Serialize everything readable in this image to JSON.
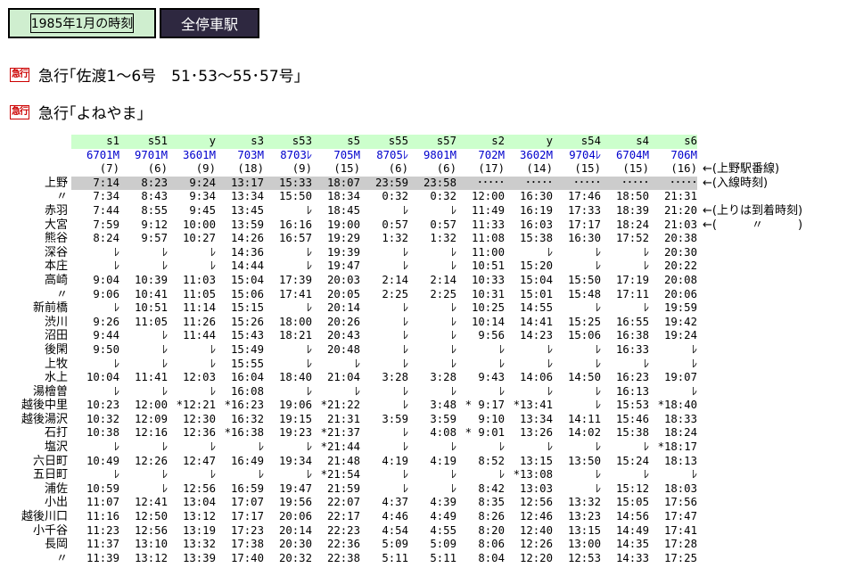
{
  "header": {
    "date_label": "1985年1月の時刻",
    "all_stations_label": "全停車駅"
  },
  "links": [
    {
      "icon": "急行",
      "label": "急行｢佐渡1～6号　51･53～55･57号｣"
    },
    {
      "icon": "急行",
      "label": "急行｢よねやま｣"
    }
  ],
  "timetable": {
    "types": [
      "s1",
      "s51",
      "y",
      "s3",
      "s53",
      "s5",
      "s55",
      "s57",
      "s2",
      "y",
      "s54",
      "s4",
      "s6"
    ],
    "numbers": [
      "6701M",
      "9701M",
      "3601M",
      "703M",
      "8703ﾚ",
      "705M",
      "8705ﾚ",
      "9801M",
      "702M",
      "3602M",
      "9704ﾚ",
      "6704M",
      "706M"
    ],
    "ueno_tracks": [
      "(7)",
      "(6)",
      "(9)",
      "(18)",
      "(9)",
      "(15)",
      "(6)",
      "(6)",
      "(17)",
      "(14)",
      "(15)",
      "(15)",
      "(16)"
    ],
    "ueno_tracks_note": "←(上野駅番線)",
    "rows": [
      {
        "station": "上野",
        "note": "←(入線時刻)",
        "times": [
          "7:14",
          "8:23",
          "9:24",
          "13:17",
          "15:33",
          "18:07",
          "23:59",
          "23:58",
          "･････",
          "･････",
          "･････",
          "･････",
          "･････"
        ]
      },
      {
        "station": "〃",
        "note": "",
        "times": [
          "7:34",
          "8:43",
          "9:34",
          "13:34",
          "15:50",
          "18:34",
          "0:32",
          "0:32",
          "12:00",
          "16:30",
          "17:46",
          "18:50",
          "21:31"
        ]
      },
      {
        "station": "赤羽",
        "note": "←(上りは到着時刻)",
        "times": [
          "7:44",
          "8:55",
          "9:45",
          "13:45",
          "ﾚ",
          "18:45",
          "ﾚ",
          "ﾚ",
          "11:49",
          "16:19",
          "17:33",
          "18:39",
          "21:20"
        ]
      },
      {
        "station": "大宮",
        "note": "←(　　　〃　　　)",
        "times": [
          "7:59",
          "9:12",
          "10:00",
          "13:59",
          "16:16",
          "19:00",
          "0:57",
          "0:57",
          "11:33",
          "16:03",
          "17:17",
          "18:24",
          "21:03"
        ]
      },
      {
        "station": "熊谷",
        "note": "",
        "times": [
          "8:24",
          "9:57",
          "10:27",
          "14:26",
          "16:57",
          "19:29",
          "1:32",
          "1:32",
          "11:08",
          "15:38",
          "16:30",
          "17:52",
          "20:38"
        ]
      },
      {
        "station": "深谷",
        "note": "",
        "times": [
          "ﾚ",
          "ﾚ",
          "ﾚ",
          "14:36",
          "ﾚ",
          "19:39",
          "ﾚ",
          "ﾚ",
          "11:00",
          "ﾚ",
          "ﾚ",
          "ﾚ",
          "20:30"
        ]
      },
      {
        "station": "本庄",
        "note": "",
        "times": [
          "ﾚ",
          "ﾚ",
          "ﾚ",
          "14:44",
          "ﾚ",
          "19:47",
          "ﾚ",
          "ﾚ",
          "10:51",
          "15:20",
          "ﾚ",
          "ﾚ",
          "20:22"
        ]
      },
      {
        "station": "高崎",
        "note": "",
        "times": [
          "9:04",
          "10:39",
          "11:03",
          "15:04",
          "17:39",
          "20:03",
          "2:14",
          "2:14",
          "10:33",
          "15:04",
          "15:50",
          "17:19",
          "20:08"
        ]
      },
      {
        "station": "〃",
        "note": "",
        "times": [
          "9:06",
          "10:41",
          "11:05",
          "15:06",
          "17:41",
          "20:05",
          "2:25",
          "2:25",
          "10:31",
          "15:01",
          "15:48",
          "17:11",
          "20:06"
        ]
      },
      {
        "station": "新前橋",
        "note": "",
        "times": [
          "ﾚ",
          "10:51",
          "11:14",
          "15:15",
          "ﾚ",
          "20:14",
          "ﾚ",
          "ﾚ",
          "10:25",
          "14:55",
          "ﾚ",
          "ﾚ",
          "19:59"
        ]
      },
      {
        "station": "渋川",
        "note": "",
        "times": [
          "9:26",
          "11:05",
          "11:26",
          "15:26",
          "18:00",
          "20:26",
          "ﾚ",
          "ﾚ",
          "10:14",
          "14:41",
          "15:25",
          "16:55",
          "19:42"
        ]
      },
      {
        "station": "沼田",
        "note": "",
        "times": [
          "9:44",
          "ﾚ",
          "11:44",
          "15:43",
          "18:21",
          "20:43",
          "ﾚ",
          "ﾚ",
          "9:56",
          "14:23",
          "15:06",
          "16:38",
          "19:24"
        ]
      },
      {
        "station": "後閑",
        "note": "",
        "times": [
          "9:50",
          "ﾚ",
          "ﾚ",
          "15:49",
          "ﾚ",
          "20:48",
          "ﾚ",
          "ﾚ",
          "ﾚ",
          "ﾚ",
          "ﾚ",
          "16:33",
          "ﾚ"
        ]
      },
      {
        "station": "上牧",
        "note": "",
        "times": [
          "ﾚ",
          "ﾚ",
          "ﾚ",
          "15:55",
          "ﾚ",
          "ﾚ",
          "ﾚ",
          "ﾚ",
          "ﾚ",
          "ﾚ",
          "ﾚ",
          "ﾚ",
          "ﾚ"
        ]
      },
      {
        "station": "水上",
        "note": "",
        "times": [
          "10:04",
          "11:41",
          "12:03",
          "16:04",
          "18:40",
          "21:04",
          "3:28",
          "3:28",
          "9:43",
          "14:06",
          "14:50",
          "16:23",
          "19:07"
        ]
      },
      {
        "station": "湯檜曽",
        "note": "",
        "times": [
          "ﾚ",
          "ﾚ",
          "ﾚ",
          "16:08",
          "ﾚ",
          "ﾚ",
          "ﾚ",
          "ﾚ",
          "ﾚ",
          "ﾚ",
          "ﾚ",
          "16:13",
          "ﾚ"
        ]
      },
      {
        "station": "越後中里",
        "note": "",
        "times": [
          "10:23",
          "12:00",
          "*12:21",
          "*16:23",
          "19:06",
          "*21:22",
          "ﾚ",
          "3:48",
          "* 9:17",
          "*13:41",
          "ﾚ",
          "15:53",
          "*18:40"
        ]
      },
      {
        "station": "越後湯沢",
        "note": "",
        "times": [
          "10:32",
          "12:09",
          "12:30",
          "16:32",
          "19:15",
          "21:31",
          "3:59",
          "3:59",
          "9:10",
          "13:34",
          "14:11",
          "15:46",
          "18:33"
        ]
      },
      {
        "station": "石打",
        "note": "",
        "times": [
          "10:38",
          "12:16",
          "12:36",
          "*16:38",
          "19:23",
          "*21:37",
          "ﾚ",
          "4:08",
          "* 9:01",
          "13:26",
          "14:02",
          "15:38",
          "18:24"
        ]
      },
      {
        "station": "塩沢",
        "note": "",
        "times": [
          "ﾚ",
          "ﾚ",
          "ﾚ",
          "ﾚ",
          "ﾚ",
          "*21:44",
          "ﾚ",
          "ﾚ",
          "ﾚ",
          "ﾚ",
          "ﾚ",
          "ﾚ",
          "*18:17"
        ]
      },
      {
        "station": "六日町",
        "note": "",
        "times": [
          "10:49",
          "12:26",
          "12:47",
          "16:49",
          "19:34",
          "21:48",
          "4:19",
          "4:19",
          "8:52",
          "13:15",
          "13:50",
          "15:24",
          "18:13"
        ]
      },
      {
        "station": "五日町",
        "note": "",
        "times": [
          "ﾚ",
          "ﾚ",
          "ﾚ",
          "ﾚ",
          "ﾚ",
          "*21:54",
          "ﾚ",
          "ﾚ",
          "ﾚ",
          "*13:08",
          "ﾚ",
          "ﾚ",
          "ﾚ"
        ]
      },
      {
        "station": "浦佐",
        "note": "",
        "times": [
          "10:59",
          "ﾚ",
          "12:56",
          "16:59",
          "19:47",
          "21:59",
          "ﾚ",
          "ﾚ",
          "8:42",
          "13:03",
          "ﾚ",
          "15:12",
          "18:03"
        ]
      },
      {
        "station": "小出",
        "note": "",
        "times": [
          "11:07",
          "12:41",
          "13:04",
          "17:07",
          "19:56",
          "22:07",
          "4:37",
          "4:39",
          "8:35",
          "12:56",
          "13:32",
          "15:05",
          "17:56"
        ]
      },
      {
        "station": "越後川口",
        "note": "",
        "times": [
          "11:16",
          "12:50",
          "13:12",
          "17:17",
          "20:06",
          "22:17",
          "4:46",
          "4:49",
          "8:26",
          "12:46",
          "13:23",
          "14:56",
          "17:47"
        ]
      },
      {
        "station": "小千谷",
        "note": "",
        "times": [
          "11:23",
          "12:56",
          "13:19",
          "17:23",
          "20:14",
          "22:23",
          "4:54",
          "4:55",
          "8:20",
          "12:40",
          "13:15",
          "14:49",
          "17:41"
        ]
      },
      {
        "station": "長岡",
        "note": "",
        "times": [
          "11:37",
          "13:10",
          "13:32",
          "17:38",
          "20:30",
          "22:36",
          "5:09",
          "5:09",
          "8:06",
          "12:26",
          "13:00",
          "14:35",
          "17:28"
        ]
      },
      {
        "station": "〃",
        "note": "",
        "times": [
          "11:39",
          "13:12",
          "13:39",
          "17:40",
          "20:32",
          "22:38",
          "5:11",
          "5:11",
          "8:04",
          "12:20",
          "12:53",
          "14:33",
          "17:25"
        ]
      }
    ]
  },
  "colors": {
    "header_date_bg": "#cfeecf",
    "header_active_bg": "#2e2840",
    "type_row_bg": "#ccffcc",
    "train_number_color": "#0000cc",
    "arrival_row_bg": "#cccccc",
    "kyuko_icon": "#cc0000"
  }
}
